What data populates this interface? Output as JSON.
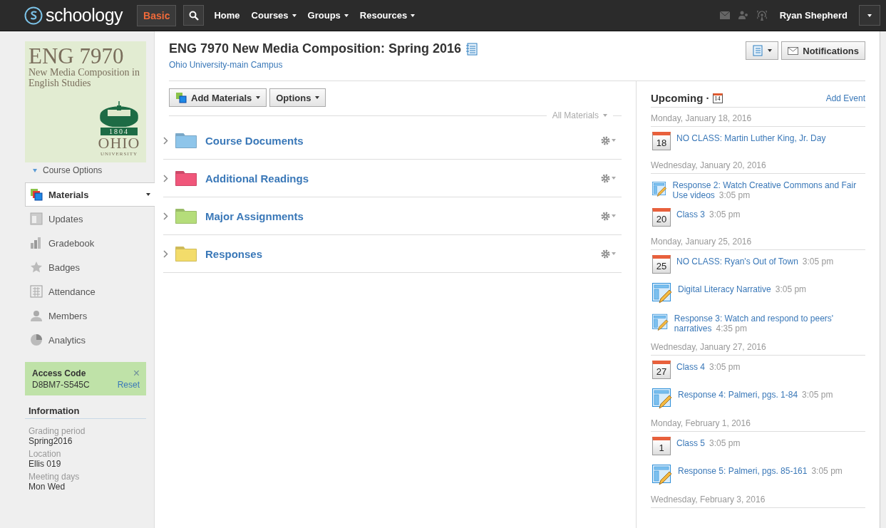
{
  "topbar": {
    "logo": "schoology",
    "mode": "Basic",
    "nav": [
      {
        "label": "Home",
        "dropdown": false
      },
      {
        "label": "Courses",
        "dropdown": true
      },
      {
        "label": "Groups",
        "dropdown": true
      },
      {
        "label": "Resources",
        "dropdown": true
      }
    ],
    "user": "Ryan Shepherd"
  },
  "sidebar": {
    "course_image": {
      "code": "ENG 7970",
      "subtitle": "New Media Composition in English Studies",
      "year": "1804",
      "school": "OHIO",
      "school_sub": "UNIVERSITY"
    },
    "course_options": "Course Options",
    "items": [
      {
        "label": "Materials",
        "selected": true
      },
      {
        "label": "Updates",
        "selected": false
      },
      {
        "label": "Gradebook",
        "selected": false
      },
      {
        "label": "Badges",
        "selected": false
      },
      {
        "label": "Attendance",
        "selected": false
      },
      {
        "label": "Members",
        "selected": false
      },
      {
        "label": "Analytics",
        "selected": false
      }
    ],
    "access_code": {
      "title": "Access Code",
      "close": "×",
      "code": "D8BM7-S545C",
      "reset": "Reset"
    },
    "information": {
      "title": "Information",
      "fields": [
        {
          "label": "Grading period",
          "value": "Spring2016"
        },
        {
          "label": "Location",
          "value": "Ellis 019"
        },
        {
          "label": "Meeting days",
          "value": "Mon Wed"
        }
      ]
    }
  },
  "header": {
    "title": "ENG 7970 New Media Composition: Spring 2016",
    "school": "Ohio University-main Campus",
    "notifications": "Notifications"
  },
  "toolbar": {
    "add": "Add Materials",
    "options": "Options",
    "filter": "All Materials"
  },
  "folders": [
    {
      "name": "Course Documents",
      "color": "#8ec5ea"
    },
    {
      "name": "Additional Readings",
      "color": "#f0567a"
    },
    {
      "name": "Major Assignments",
      "color": "#b5dd7a"
    },
    {
      "name": "Responses",
      "color": "#f3dc6a"
    }
  ],
  "upcoming": {
    "title": "Upcoming ·",
    "calendar_day": "14",
    "add_event": "Add Event",
    "days": [
      {
        "date": "Monday, January 18, 2016",
        "events": [
          {
            "kind": "event",
            "day": "18",
            "title": "NO CLASS: Martin Luther King, Jr. Day"
          }
        ]
      },
      {
        "date": "Wednesday, January 20, 2016",
        "events": [
          {
            "kind": "assignment",
            "title": "Response 2: Watch Creative Commons and Fair Use videos",
            "time": "3:05 pm"
          },
          {
            "kind": "event",
            "day": "20",
            "title": "Class 3",
            "time": "3:05 pm"
          }
        ]
      },
      {
        "date": "Monday, January 25, 2016",
        "events": [
          {
            "kind": "event",
            "day": "25",
            "title": "NO CLASS: Ryan's Out of Town",
            "time": "3:05 pm"
          },
          {
            "kind": "assignment",
            "title": "Digital Literacy Narrative",
            "time": "3:05 pm"
          },
          {
            "kind": "assignment",
            "title": "Response 3: Watch and respond to peers' narratives",
            "time": "4:35 pm"
          }
        ]
      },
      {
        "date": "Wednesday, January 27, 2016",
        "events": [
          {
            "kind": "event",
            "day": "27",
            "title": "Class 4",
            "time": "3:05 pm"
          },
          {
            "kind": "assignment",
            "title": "Response 4: Palmeri, pgs. 1-84",
            "time": "3:05 pm"
          }
        ]
      },
      {
        "date": "Monday, February 1, 2016",
        "events": [
          {
            "kind": "event",
            "day": "1",
            "title": "Class 5",
            "time": "3:05 pm"
          },
          {
            "kind": "assignment",
            "title": "Response 5: Palmeri, pgs. 85-161",
            "time": "3:05 pm"
          }
        ]
      },
      {
        "date": "Wednesday, February 3, 2016"
      }
    ]
  }
}
